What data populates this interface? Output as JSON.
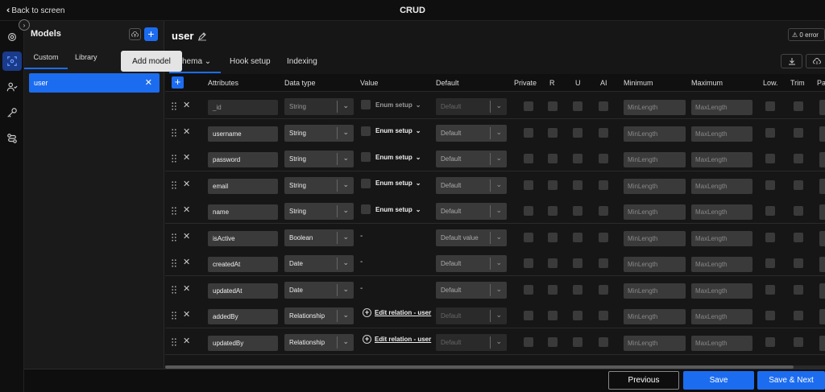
{
  "topbar": {
    "back_label": "Back to screen",
    "title": "CRUD"
  },
  "rail": {
    "icons": [
      "settings-cog-icon",
      "models-icon",
      "users-icon",
      "key-icon",
      "flow-icon"
    ]
  },
  "models_panel": {
    "title": "Models",
    "add_tooltip": "Add model",
    "tabs": [
      "Custom",
      "Library"
    ],
    "items": [
      {
        "label": "user"
      }
    ]
  },
  "main": {
    "title": "user",
    "error_badge": "0 error",
    "tabs": [
      "Schema",
      "Hook setup",
      "Indexing"
    ],
    "visible_first_tab": "hema"
  },
  "table": {
    "headers": {
      "attributes": "Attributes",
      "data_type": "Data type",
      "value": "Value",
      "default": "Default",
      "private": "Private",
      "r": "R",
      "u": "U",
      "ai": "AI",
      "minimum": "Minimum",
      "maximum": "Maximum",
      "low": "Low.",
      "trim": "Trim",
      "p": "Pa"
    },
    "placeholders": {
      "default": "Default",
      "min": "MinLength",
      "max": "MaxLength"
    },
    "rows": [
      {
        "name": "_id",
        "type": "String",
        "value": "Enum setup",
        "default": "Default",
        "disabled": true
      },
      {
        "name": "username",
        "type": "String",
        "value": "Enum setup",
        "default": "Default"
      },
      {
        "name": "password",
        "type": "String",
        "value": "Enum setup",
        "default": "Default"
      },
      {
        "name": "email",
        "type": "String",
        "value": "Enum setup",
        "default": "Default"
      },
      {
        "name": "name",
        "type": "String",
        "value": "Enum setup",
        "default": "Default"
      },
      {
        "name": "isActive",
        "type": "Boolean",
        "value": "-",
        "default": "Default value"
      },
      {
        "name": "createdAt",
        "type": "Date",
        "value": "-",
        "default": "Default"
      },
      {
        "name": "updatedAt",
        "type": "Date",
        "value": "-",
        "default": "Default"
      },
      {
        "name": "addedBy",
        "type": "Relationship",
        "value": "Edit relation - user",
        "default": "Default",
        "default_disabled": true
      },
      {
        "name": "updatedBy",
        "type": "Relationship",
        "value": "Edit relation - user",
        "default": "Default",
        "default_disabled": true
      }
    ]
  },
  "footer": {
    "previous": "Previous",
    "save": "Save",
    "save_next": "Save & Next"
  },
  "colors": {
    "accent": "#1c6cf0",
    "background": "#161616",
    "panel": "#1a1a1a",
    "input": "#3a3a3a"
  }
}
